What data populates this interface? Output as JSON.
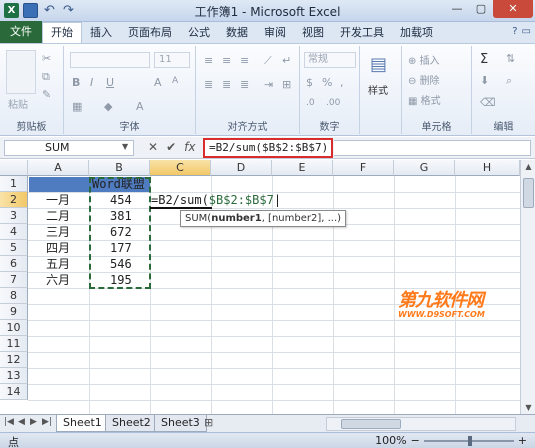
{
  "window": {
    "title": "工作簿1 - Microsoft Excel",
    "app_icon": "X",
    "undo_icon": "↶",
    "redo_icon": "↷"
  },
  "tabs": [
    "文件",
    "开始",
    "插入",
    "页面布局",
    "公式",
    "数据",
    "审阅",
    "视图",
    "开发工具",
    "加载项"
  ],
  "ribbon": {
    "paste": "粘贴",
    "font_size": "11",
    "number_format": "常规",
    "groups": [
      "剪贴板",
      "字体",
      "对齐方式",
      "数字",
      "单元格",
      "编辑"
    ],
    "cells_buttons": [
      "插入",
      "删除",
      "格式"
    ],
    "styles_label": "样式"
  },
  "formula_bar": {
    "name_box": "SUM",
    "formula": "=B2/sum($B$2:$B$7)"
  },
  "grid": {
    "columns": [
      "A",
      "B",
      "C",
      "D",
      "E",
      "F",
      "G",
      "H"
    ],
    "rows": [
      "1",
      "2",
      "3",
      "4",
      "5",
      "6",
      "7",
      "8",
      "9",
      "10",
      "11",
      "12",
      "13",
      "14"
    ],
    "header_cell": "Word联盟",
    "months": [
      "一月",
      "二月",
      "三月",
      "四月",
      "五月",
      "六月"
    ],
    "values": [
      "454",
      "381",
      "672",
      "177",
      "546",
      "195"
    ],
    "editing_cell_prefix": "=B2/sum(",
    "editing_cell_ref": "$B$2:$B$7",
    "tooltip": {
      "func": "SUM(",
      "arg1": "number1",
      "rest": ", [number2], ...)"
    }
  },
  "watermark": {
    "line1": "第九软件网",
    "line2": "WWW.D9SOFT.COM"
  },
  "sheets": [
    "Sheet1",
    "Sheet2",
    "Sheet3"
  ],
  "status": {
    "mode": "点",
    "zoom": "100%"
  }
}
